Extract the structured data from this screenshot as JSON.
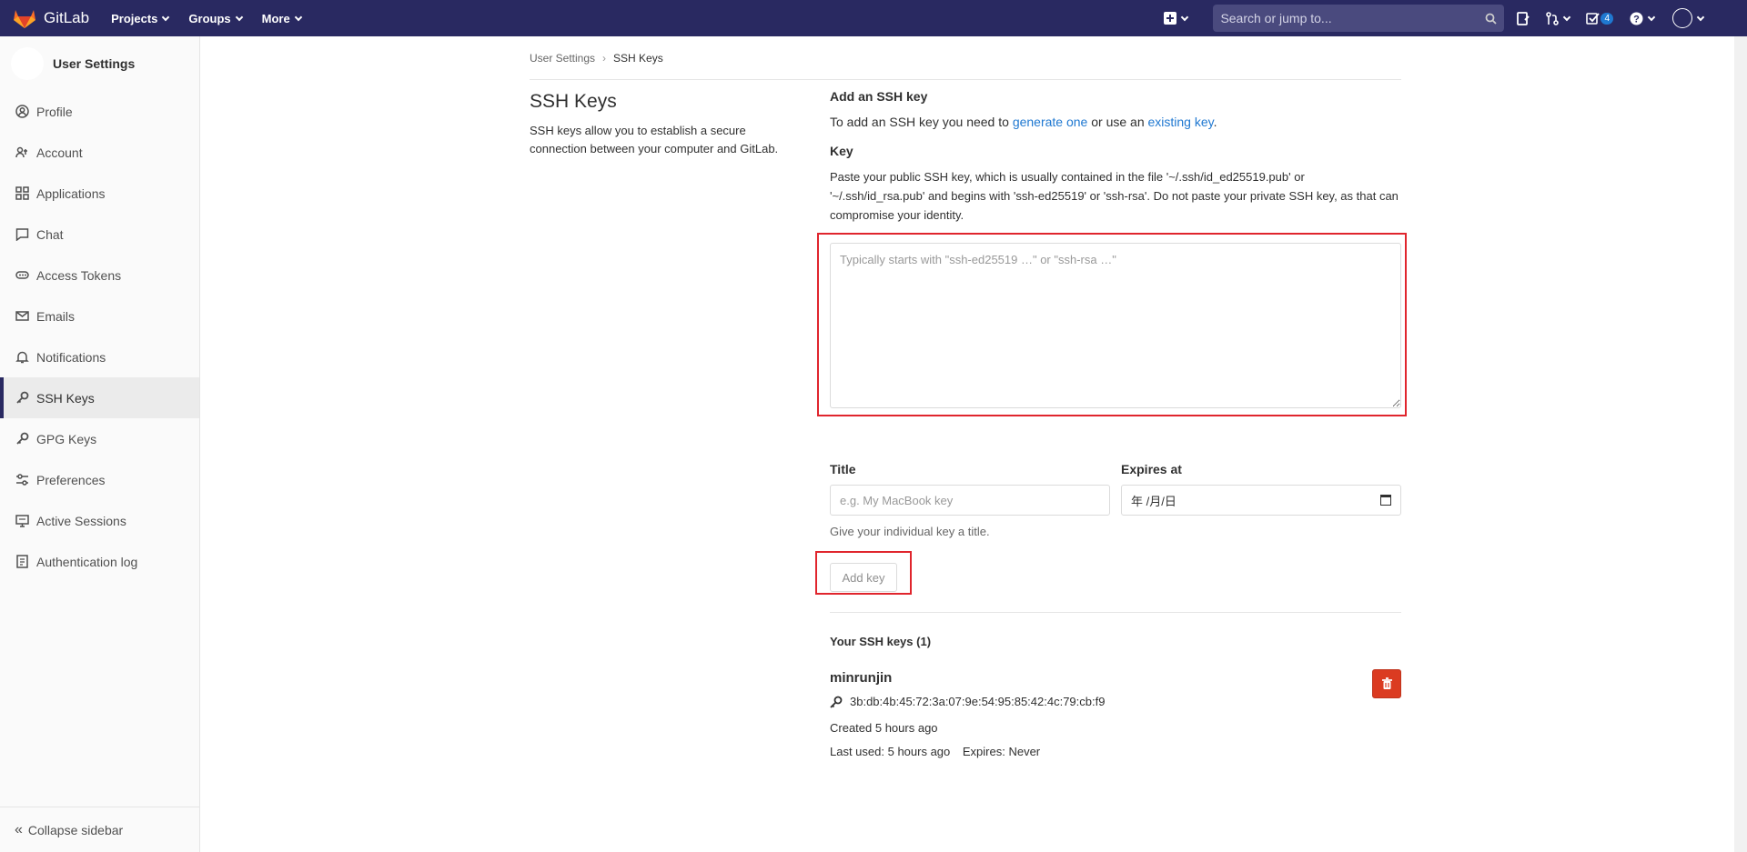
{
  "brand": {
    "name": "GitLab"
  },
  "nav": {
    "items": [
      "Projects",
      "Groups",
      "More"
    ]
  },
  "search": {
    "placeholder": "Search or jump to..."
  },
  "todos_count": "4",
  "sidebar": {
    "title": "User Settings",
    "items": [
      {
        "label": "Profile",
        "icon": "profile-icon"
      },
      {
        "label": "Account",
        "icon": "account-icon"
      },
      {
        "label": "Applications",
        "icon": "applications-icon"
      },
      {
        "label": "Chat",
        "icon": "chat-icon"
      },
      {
        "label": "Access Tokens",
        "icon": "token-icon"
      },
      {
        "label": "Emails",
        "icon": "mail-icon"
      },
      {
        "label": "Notifications",
        "icon": "bell-icon"
      },
      {
        "label": "SSH Keys",
        "icon": "key-icon",
        "active": true
      },
      {
        "label": "GPG Keys",
        "icon": "key-icon"
      },
      {
        "label": "Preferences",
        "icon": "preferences-icon"
      },
      {
        "label": "Active Sessions",
        "icon": "monitor-icon"
      },
      {
        "label": "Authentication log",
        "icon": "log-icon"
      }
    ],
    "collapse_label": "Collapse sidebar"
  },
  "breadcrumb": {
    "parent": "User Settings",
    "current": "SSH Keys"
  },
  "page": {
    "title": "SSH Keys",
    "description": "SSH keys allow you to establish a secure connection between your computer and GitLab."
  },
  "form": {
    "heading": "Add an SSH key",
    "intro_prefix": "To add an SSH key you need to ",
    "generate_link": "generate one",
    "intro_middle": " or use an ",
    "existing_link": "existing key",
    "intro_suffix": ".",
    "key_label": "Key",
    "key_help": "Paste your public SSH key, which is usually contained in the file '~/.ssh/id_ed25519.pub' or '~/.ssh/id_rsa.pub' and begins with 'ssh-ed25519' or 'ssh-rsa'. Do not paste your private SSH key, as that can compromise your identity.",
    "key_placeholder": "Typically starts with \"ssh-ed25519 …\" or \"ssh-rsa …\"",
    "title_label": "Title",
    "title_placeholder": "e.g. My MacBook key",
    "expires_label": "Expires at",
    "expires_value": "年 /月/日",
    "title_help": "Give your individual key a title.",
    "add_button": "Add key"
  },
  "keys": {
    "heading": "Your SSH keys (1)",
    "items": [
      {
        "title": "minrunjin",
        "fingerprint": "3b:db:4b:45:72:3a:07:9e:54:95:85:42:4c:79:cb:f9",
        "created": "Created 5 hours ago",
        "last_used": "Last used: 5 hours ago",
        "expires": "Expires: Never"
      }
    ]
  },
  "colors": {
    "navbar": "#292961",
    "delete": "#db3b21",
    "highlight": "#e0252d",
    "link": "#1f78d1"
  }
}
